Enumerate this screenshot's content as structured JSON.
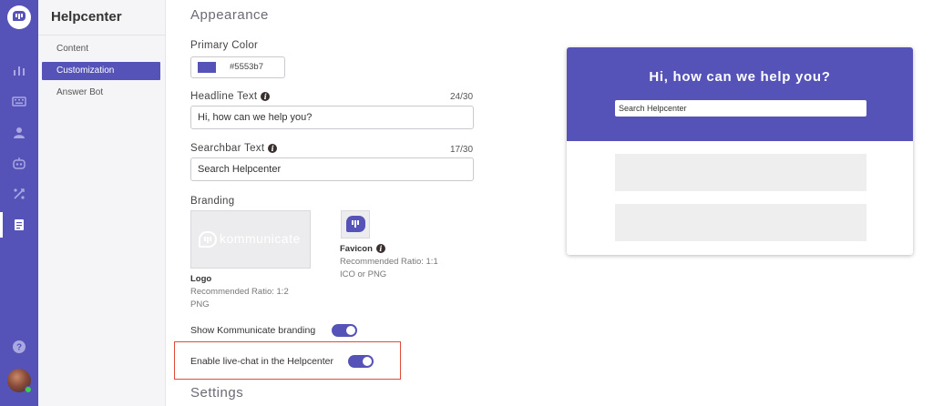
{
  "app": {
    "section_title": "Helpcenter",
    "nav_items": [
      {
        "label": "Content"
      },
      {
        "label": "Customization"
      },
      {
        "label": "Answer Bot"
      }
    ],
    "rail_icons": [
      "chat-logo-icon",
      "bar-chart-icon",
      "keyboard-icon",
      "users-icon",
      "bot-icon",
      "integrations-icon",
      "helpcenter-icon",
      "help-icon",
      "user-avatar"
    ]
  },
  "appearance": {
    "heading": "Appearance",
    "primary_color": {
      "label": "Primary Color",
      "value": "#5553b7"
    },
    "headline": {
      "label": "Headline Text",
      "count": "24/30",
      "value": "Hi, how can we help you?"
    },
    "searchbar": {
      "label": "Searchbar Text",
      "count": "17/30",
      "value": "Search Helpcenter"
    },
    "branding": {
      "label": "Branding",
      "logo": {
        "wordmark": "kommunicate",
        "title": "Logo",
        "ratio": "Recommended Ratio: 1:2",
        "format": "PNG"
      },
      "favicon": {
        "title": "Favicon",
        "ratio": "Recommended Ratio: 1:1",
        "format": "ICO or PNG"
      }
    },
    "show_branding": {
      "label": "Show Kommunicate branding",
      "enabled": true
    },
    "live_chat": {
      "label": "Enable live-chat in the Helpcenter",
      "enabled": true
    }
  },
  "settings": {
    "heading": "Settings"
  },
  "preview": {
    "headline": "Hi, how can we help you?",
    "search_placeholder": "Search Helpcenter",
    "card_count": 2
  },
  "colors": {
    "accent": "#5553b7",
    "highlight_border": "#e04a3a"
  }
}
